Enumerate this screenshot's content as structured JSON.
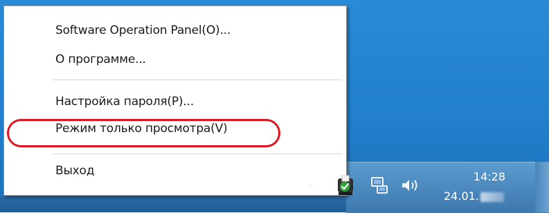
{
  "context_menu": {
    "items": [
      {
        "label": "Software Operation Panel(O)..."
      },
      {
        "label": "О программе..."
      },
      {
        "label": "Настройка пароля(P)..."
      },
      {
        "label": "Режим только просмотра(V)"
      },
      {
        "label": "Выход"
      }
    ],
    "highlighted_item": "Режим только просмотра(V)",
    "highlight_color": "#e0141e"
  },
  "tray": {
    "time": "14:28",
    "date": "24.01.",
    "icons": [
      "scanner-icon",
      "network-icon",
      "volume-icon"
    ]
  },
  "colors": {
    "desktop": "#2280cd",
    "taskbar": "#4d8bc0",
    "menu_background": "#ffffff"
  }
}
